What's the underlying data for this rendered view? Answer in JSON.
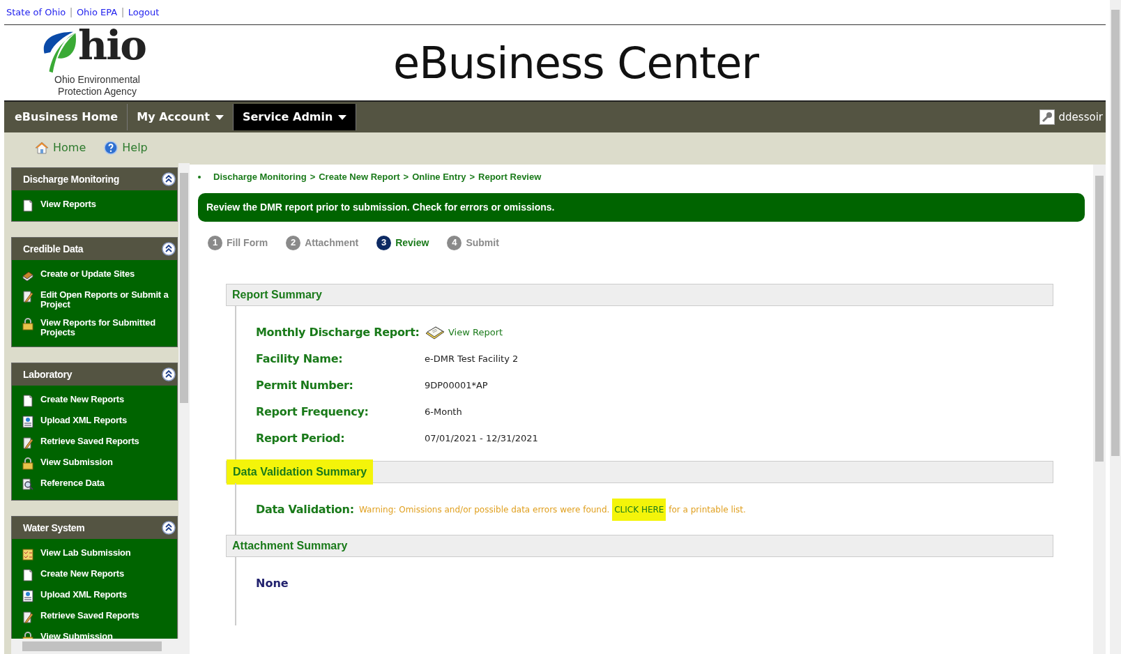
{
  "top_links": [
    {
      "label": "State of Ohio"
    },
    {
      "label": "Ohio EPA",
      "separator": "|"
    },
    {
      "label": "Logout",
      "separator": "|"
    }
  ],
  "logo": {
    "wordmark": "hio",
    "tagline_lines": [
      "Ohio Environmental",
      "Protection Agency"
    ]
  },
  "header": {
    "title": "eBusiness Center"
  },
  "nav": {
    "items": [
      {
        "label": "eBusiness Home",
        "dropdown": false,
        "selected": false
      },
      {
        "label": "My Account",
        "dropdown": true,
        "selected": false
      },
      {
        "label": "Service Admin",
        "dropdown": true,
        "selected": true
      }
    ],
    "user": "ddessoir"
  },
  "subnav": [
    {
      "label": "Home",
      "kind": "home"
    },
    {
      "label": "Help",
      "kind": "help"
    }
  ],
  "sidebar": {
    "sections": [
      {
        "title": "Discharge Monitoring",
        "expanded": true,
        "items": [
          {
            "label": "View Reports",
            "kind": "document"
          }
        ]
      },
      {
        "title": "Credible Data",
        "expanded": true,
        "items": [
          {
            "label": "Create or Update Sites",
            "kind": "sites"
          },
          {
            "label": "Edit Open Reports or Submit a Project",
            "kind": "pencil"
          },
          {
            "label": "View Reports for Submitted Projects",
            "kind": "lock"
          }
        ]
      },
      {
        "title": "Laboratory",
        "expanded": true,
        "items": [
          {
            "label": "Create New Reports",
            "kind": "document"
          },
          {
            "label": "Upload XML Reports",
            "kind": "xml"
          },
          {
            "label": "Retrieve Saved Reports",
            "kind": "pencil"
          },
          {
            "label": "View Submission",
            "kind": "lock"
          },
          {
            "label": "Reference Data",
            "kind": "magnifier"
          }
        ]
      },
      {
        "title": "Water System",
        "expanded": true,
        "items": [
          {
            "label": "View Lab Submission",
            "kind": "checklist"
          },
          {
            "label": "Create New Reports",
            "kind": "document"
          },
          {
            "label": "Upload XML Reports",
            "kind": "xml"
          },
          {
            "label": "Retrieve Saved Reports",
            "kind": "pencil"
          },
          {
            "label": "View Submission",
            "kind": "lock"
          }
        ]
      }
    ]
  },
  "breadcrumb": [
    {
      "label": "Discharge Monitoring"
    },
    {
      "label": "Create New Report",
      "separator": ">"
    },
    {
      "label": "Online Entry",
      "separator": ">"
    },
    {
      "label": "Report Review",
      "separator": ">"
    }
  ],
  "banner": "Review the DMR report prior to submission. Check for errors or omissions.",
  "steps": [
    {
      "number": "1",
      "label": "Fill Form",
      "selected": false
    },
    {
      "number": "2",
      "label": "Attachment",
      "selected": false
    },
    {
      "number": "3",
      "label": "Review",
      "selected": true
    },
    {
      "number": "4",
      "label": "Submit",
      "selected": false
    }
  ],
  "report_summary": {
    "title": "Report Summary",
    "rows": [
      {
        "label": "Monthly Discharge Report:",
        "kind": "link",
        "value": "View Report"
      },
      {
        "label": "Facility Name:",
        "kind": "text",
        "value": "e-DMR Test Facility 2"
      },
      {
        "label": "Permit Number:",
        "kind": "text",
        "value": "9DP00001*AP"
      },
      {
        "label": "Report Frequency:",
        "kind": "text",
        "value": "6-Month"
      },
      {
        "label": "Report Period:",
        "kind": "text",
        "value": "07/01/2021 - 12/31/2021"
      }
    ]
  },
  "validation": {
    "title": "Data Validation Summary",
    "title_highlighted": true,
    "label": "Data Validation:",
    "warning": "Warning: Omissions and/or possible data errors were found.",
    "link": "CLICK HERE",
    "link_highlighted": true,
    "tail": "for a printable list."
  },
  "attachments": {
    "title": "Attachment Summary",
    "empty_text": "None"
  }
}
